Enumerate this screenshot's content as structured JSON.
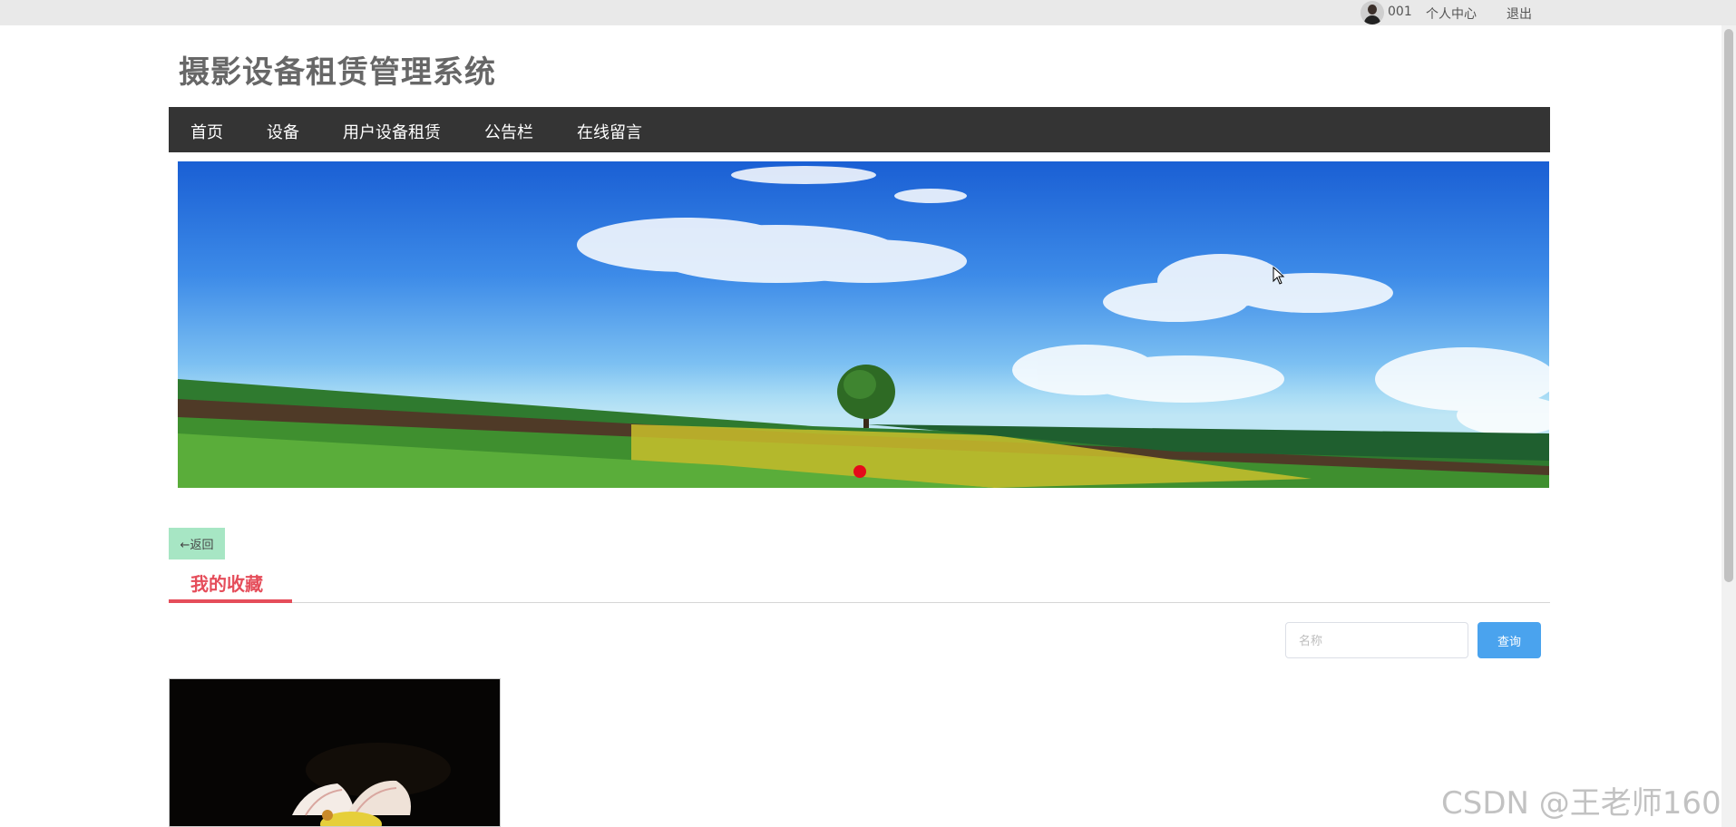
{
  "topbar": {
    "username": "001",
    "profile_label": "个人中心",
    "logout_label": "退出"
  },
  "site": {
    "title": "摄影设备租赁管理系统"
  },
  "nav": {
    "items": [
      {
        "label": "首页"
      },
      {
        "label": "设备"
      },
      {
        "label": "用户设备租赁"
      },
      {
        "label": "公告栏"
      },
      {
        "label": "在线留言"
      }
    ]
  },
  "banner": {
    "active_slide": 1
  },
  "favorites": {
    "back_label": "←返回",
    "title": "我的收藏",
    "search_placeholder": "名称",
    "search_button": "查询"
  },
  "watermark": "CSDN @王老师160",
  "colors": {
    "nav_bg": "#343434",
    "accent_red": "#e54d5a",
    "search_blue": "#4aa3ee",
    "back_green": "#a7e6c4",
    "indicator_red": "#e50b1a"
  }
}
